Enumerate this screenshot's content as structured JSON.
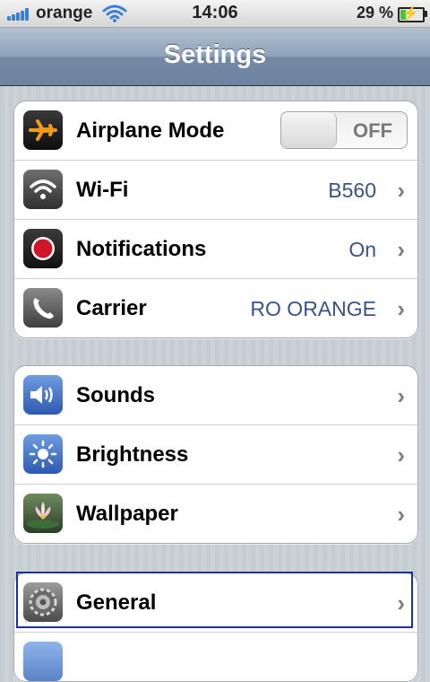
{
  "status_bar": {
    "carrier": "orange",
    "time": "14:06",
    "battery": "29 %",
    "battery_level": 0.29,
    "signal_icon": "signal-bars-icon",
    "wifi_icon": "wifi-icon",
    "charging_icon": "charging-bolt-icon"
  },
  "nav": {
    "title": "Settings"
  },
  "group1": {
    "airplane": {
      "label": "Airplane Mode",
      "toggle": "OFF",
      "icon": "airplane-icon"
    },
    "wifi": {
      "label": "Wi-Fi",
      "value": "B560",
      "icon": "wifi-icon"
    },
    "notifications": {
      "label": "Notifications",
      "value": "On",
      "icon": "notifications-icon"
    },
    "carrier": {
      "label": "Carrier",
      "value": "RO ORANGE",
      "icon": "phone-icon"
    }
  },
  "group2": {
    "sounds": {
      "label": "Sounds",
      "icon": "speaker-icon"
    },
    "brightness": {
      "label": "Brightness",
      "icon": "sun-icon"
    },
    "wallpaper": {
      "label": "Wallpaper",
      "icon": "flower-icon"
    }
  },
  "group3": {
    "general": {
      "label": "General",
      "icon": "gear-icon"
    }
  },
  "chevron": "›",
  "colors": {
    "value_text": "#385487",
    "nav_bar": "#8ea2ba",
    "focus_outline": "#1a3399"
  }
}
